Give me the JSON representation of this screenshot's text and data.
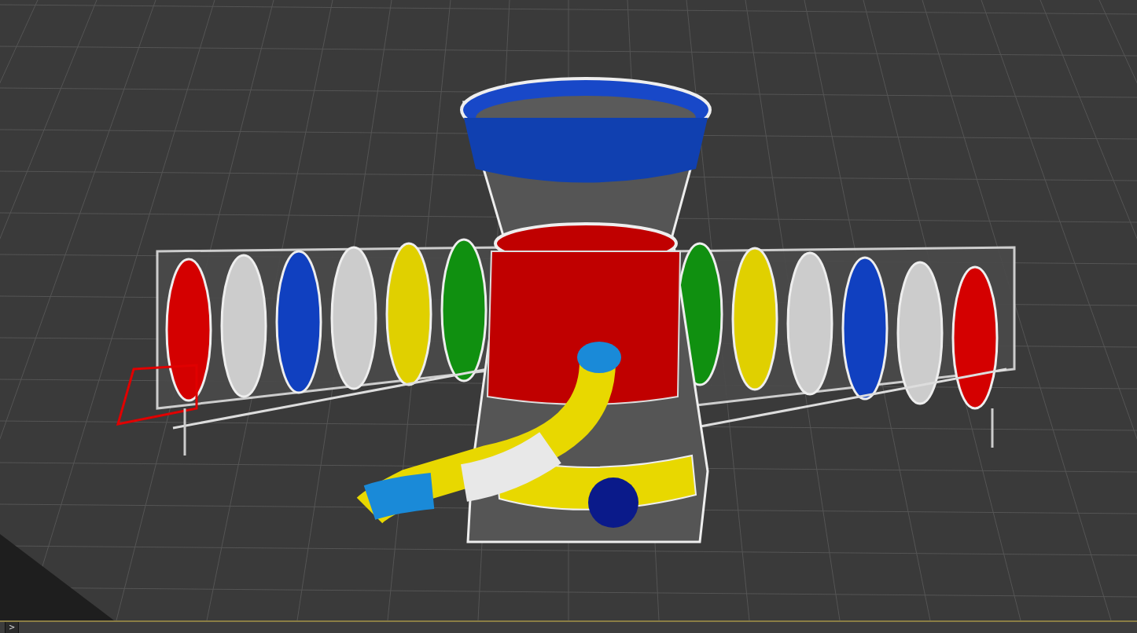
{
  "status_bar": {
    "expand_button": ">"
  }
}
